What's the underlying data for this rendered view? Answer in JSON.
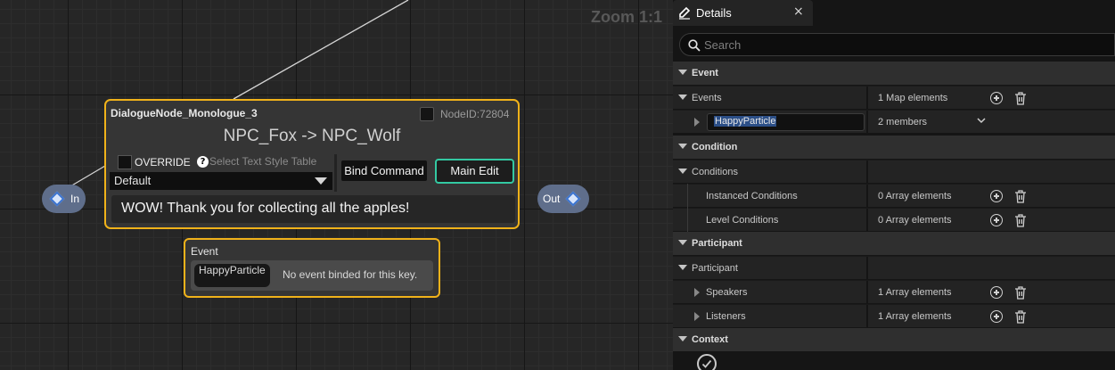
{
  "graph": {
    "zoom_label": "Zoom 1:1",
    "in_pin": "In",
    "out_pin": "Out",
    "node": {
      "title": "DialogueNode_Monologue_3",
      "node_id": "NodeID:72804",
      "speaker_line": "NPC_Fox -> NPC_Wolf",
      "override_label": "OVERRIDE",
      "help_icon": "?",
      "style_label": "Select Text Style Table",
      "style_value": "Default",
      "bind_command": "Bind Command",
      "main_edit": "Main Edit",
      "dialogue": "WOW! Thank you for collecting all the apples!"
    },
    "event_node": {
      "title": "Event",
      "key": "HappyParticle",
      "message": "No event binded for this key."
    }
  },
  "details": {
    "tab_label": "Details",
    "tab_close": "×",
    "search_placeholder": "Search",
    "event_category": "Event",
    "events_label": "Events",
    "events_value": "1 Map elements",
    "happy_particle": "HappyParticle",
    "members_value": "2 members",
    "condition_category": "Condition",
    "conditions_label": "Conditions",
    "instanced_label": "Instanced Conditions",
    "instanced_value": "0 Array elements",
    "level_label": "Level Conditions",
    "level_value": "0 Array elements",
    "participant_category": "Participant",
    "participant_label": "Participant",
    "speakers_label": "Speakers",
    "speakers_value": "1 Array elements",
    "listeners_label": "Listeners",
    "listeners_value": "1 Array elements",
    "context_category": "Context"
  },
  "colors": {
    "node_border": "#f0b21a",
    "main_edit_border": "#33c9a2",
    "pin": "#5f6e8b",
    "selection": "#2c4f87"
  }
}
